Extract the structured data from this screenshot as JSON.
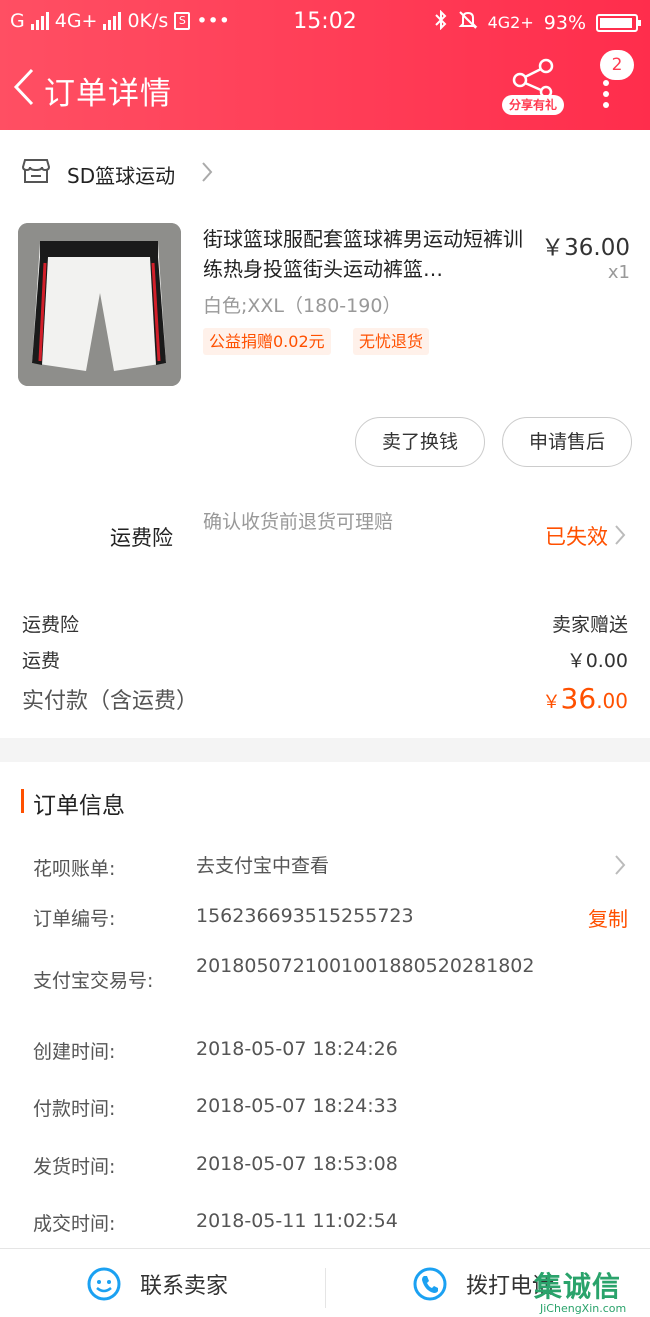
{
  "status_bar": {
    "carrier_left": "G",
    "network_1": "4G+",
    "speed": "0K/s",
    "time": "15:02",
    "network_2": "4G2+",
    "battery": "93%"
  },
  "nav": {
    "title": "订单详情",
    "share_label": "分享有礼",
    "more_badge": "2",
    "accent": "#ff3a50"
  },
  "shop": {
    "name": "SD篮球运动"
  },
  "product": {
    "title": "街球篮球服配套篮球裤男运动短裤训练热身投篮街头运动裤篮…",
    "sku": "白色;XXL（180-190）",
    "tags": [
      "公益捐赠0.02元",
      "无忧退货"
    ],
    "price": "￥36.00",
    "qty": "x1"
  },
  "actions": {
    "sell_label": "卖了换钱",
    "after_sale_label": "申请售后"
  },
  "insurance": {
    "label": "运费险",
    "desc": "确认收货前退货可理赔",
    "status": "已失效"
  },
  "fees": {
    "insurance_label": "运费险",
    "insurance_value": "卖家赠送",
    "shipping_label": "运费",
    "shipping_value": "￥0.00",
    "total_label": "实付款（含运费）",
    "total_currency": "￥",
    "total_int": "36",
    "total_dec": ".00"
  },
  "order_info": {
    "title": "订单信息",
    "rows": [
      {
        "label": "花呗账单:",
        "value": "去支付宝中查看"
      },
      {
        "label": "订单编号:",
        "value": "156236693515255723"
      },
      {
        "label": "支付宝交易号:",
        "value": "2018050721001001880520281802"
      },
      {
        "label": "创建时间:",
        "value": "2018-05-07 18:24:26"
      },
      {
        "label": "付款时间:",
        "value": "2018-05-07 18:24:33"
      },
      {
        "label": "发货时间:",
        "value": "2018-05-07 18:53:08"
      },
      {
        "label": "成交时间:",
        "value": "2018-05-11 11:02:54"
      }
    ],
    "copy_label": "复制"
  },
  "bottom": {
    "contact_label": "联系卖家",
    "call_label": "拨打电话"
  },
  "watermark": {
    "main": "集诚信",
    "sub": "JiChengXin.com"
  },
  "colors": {
    "header_gradient_start": "#ff4f63",
    "header_gradient_end": "#ff2d4c",
    "orange": "#ff5000",
    "icon_blue": "#1ba1f2"
  }
}
